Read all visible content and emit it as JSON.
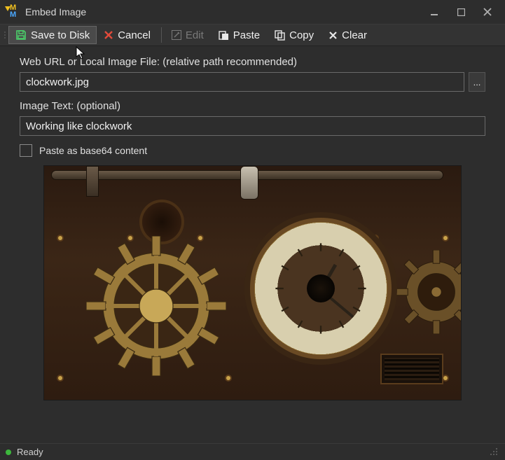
{
  "window": {
    "title": "Embed Image"
  },
  "toolbar": {
    "save": "Save to Disk",
    "cancel": "Cancel",
    "edit": "Edit",
    "paste": "Paste",
    "copy": "Copy",
    "clear": "Clear"
  },
  "fields": {
    "url_label": "Web URL or Local Image File: (relative path recommended)",
    "url_value": "clockwork.jpg",
    "browse_label": "...",
    "text_label": "Image Text: (optional)",
    "text_value": "Working like clockwork",
    "base64_label": "Paste as base64 content"
  },
  "status": {
    "text": "Ready"
  },
  "colors": {
    "accent_green": "#3db83d",
    "danger_red": "#e24a3b"
  }
}
